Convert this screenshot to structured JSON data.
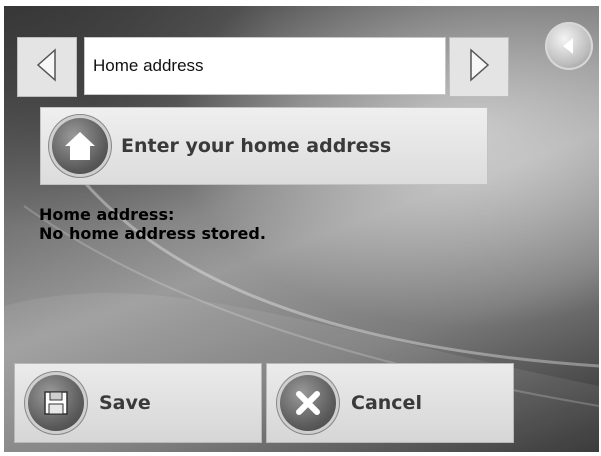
{
  "header": {
    "title_field_value": "Home address"
  },
  "actions": {
    "enter_home_label": "Enter your home address"
  },
  "info": {
    "heading": "Home address:",
    "status": "No home address stored."
  },
  "footer": {
    "save_label": "Save",
    "cancel_label": "Cancel"
  },
  "icons": {
    "back": "back-arrow-icon",
    "prev": "triangle-left-icon",
    "next": "triangle-right-icon",
    "home": "house-icon",
    "save": "floppy-disk-icon",
    "cancel": "x-mark-icon"
  }
}
